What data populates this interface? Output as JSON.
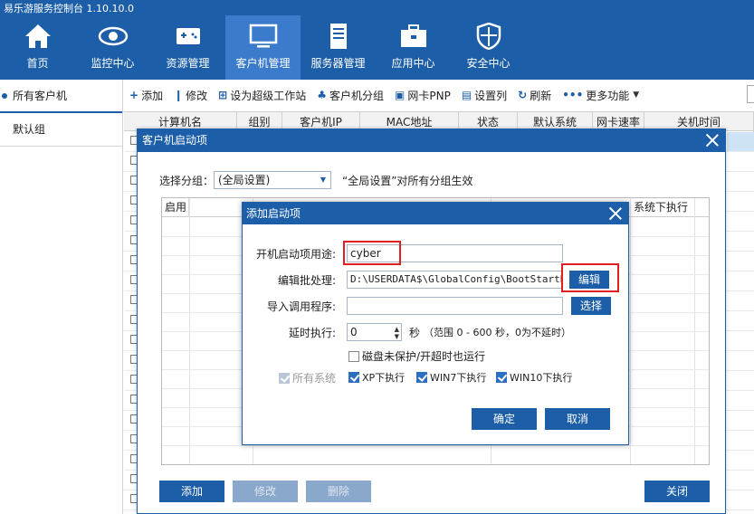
{
  "app": {
    "title": "易乐游服务控制台 1.10.10.0"
  },
  "nav": [
    {
      "label": "首页",
      "icon": "home-icon"
    },
    {
      "label": "监控中心",
      "icon": "eye-icon"
    },
    {
      "label": "资源管理",
      "icon": "gamepad-icon"
    },
    {
      "label": "客户机管理",
      "icon": "monitor-icon"
    },
    {
      "label": "服务器管理",
      "icon": "server-icon"
    },
    {
      "label": "应用中心",
      "icon": "toolbox-icon"
    },
    {
      "label": "安全中心",
      "icon": "shield-icon"
    }
  ],
  "sidebar": {
    "items": [
      {
        "label": "所有客户机"
      },
      {
        "label": "默认组"
      }
    ]
  },
  "toolbar": {
    "items": [
      {
        "icon": "+",
        "label": "添加"
      },
      {
        "icon": "❙",
        "label": "修改"
      },
      {
        "icon": "⊞",
        "label": "设为超级工作站"
      },
      {
        "icon": "♣",
        "label": "客户机分组"
      },
      {
        "icon": "▣",
        "label": "网卡PNP"
      },
      {
        "icon": "▤",
        "label": "设置列"
      },
      {
        "icon": "↻",
        "label": "刷新"
      },
      {
        "icon": "•••",
        "label": "更多功能"
      }
    ]
  },
  "bg_table": {
    "columns": [
      "计算机名",
      "组别",
      "客户机IP",
      "MAC地址",
      "状态",
      "默认系统",
      "网卡速率",
      "关机时间"
    ]
  },
  "dialog1": {
    "title": "客户机启动项",
    "group_label": "选择分组：",
    "group_value": "(全局设置)",
    "group_note": "“全局设置”对所有分组生效",
    "grid_col_enable": "启用",
    "grid_col_last": "系统下执行",
    "btn_add": "添加",
    "btn_edit": "修改",
    "btn_delete": "删除",
    "btn_close": "关闭"
  },
  "dialog2": {
    "title": "添加启动项",
    "purpose_label": "开机启动项用途:",
    "purpose_value": "cyber",
    "batch_label": "编辑批处理:",
    "batch_value": "D:\\USERDATA$\\GlobalConfig\\BootStartBat\\cyb",
    "batch_button": "编辑",
    "import_label": "导入调用程序:",
    "import_value": "",
    "import_button": "选择",
    "delay_label": "延时执行:",
    "delay_value": "0",
    "delay_unit": "秒",
    "delay_note": "（范围 0 - 600 秒，0为不延时）",
    "disk_option": "磁盘未保护/开超时也运行",
    "all_systems": "所有系统",
    "xp": "XP下执行",
    "win7": "WIN7下执行",
    "win10": "WIN10下执行",
    "ok": "确定",
    "cancel": "取消"
  },
  "colors": {
    "brand": "#1c5ea8",
    "highlight": "#e02020"
  }
}
